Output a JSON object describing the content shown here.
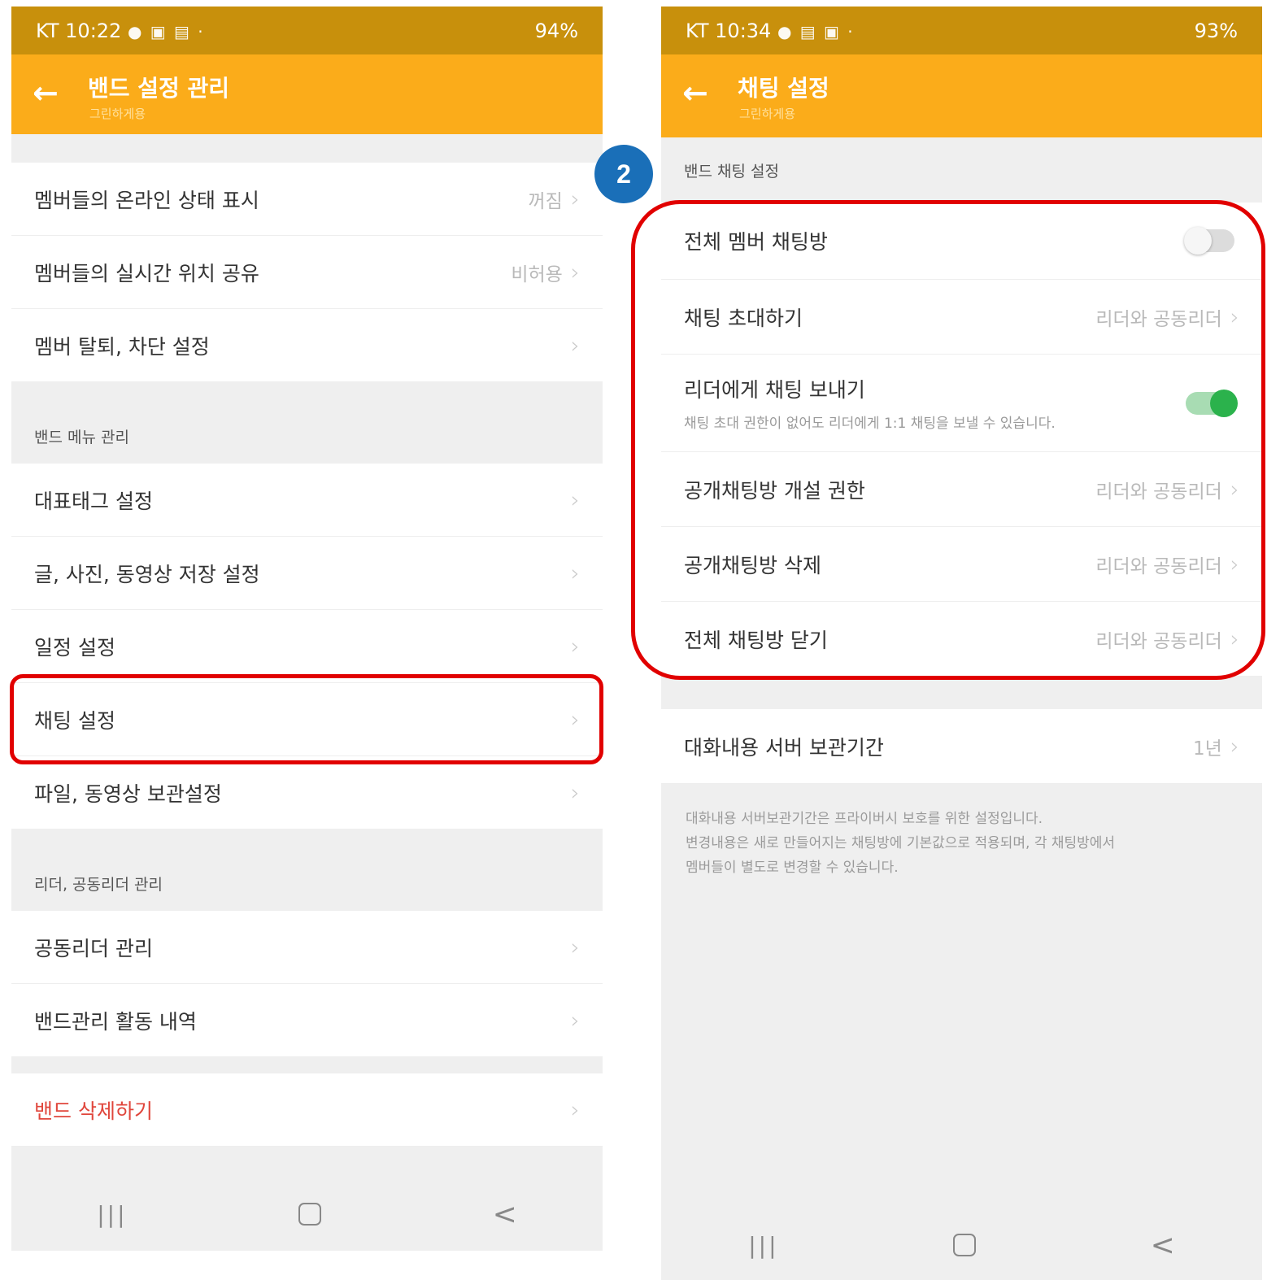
{
  "left": {
    "status": {
      "carrier_time": "KT 10:22",
      "icons": "● ▣ ▤ ·",
      "right": "94%"
    },
    "appbar": {
      "title": "밴드 설정 관리",
      "subtitle": "그린하게용"
    },
    "group1": [
      {
        "label": "멤버들의 온라인 상태 표시",
        "value": "꺼짐"
      },
      {
        "label": "멤버들의 실시간 위치 공유",
        "value": "비허용"
      },
      {
        "label": "멤버 탈퇴, 차단 설정",
        "value": ""
      }
    ],
    "section_menu": "밴드 메뉴 관리",
    "group2": [
      {
        "label": "대표태그 설정"
      },
      {
        "label": "글, 사진, 동영상 저장 설정"
      },
      {
        "label": "일정 설정"
      },
      {
        "label": "채팅 설정"
      },
      {
        "label": "파일, 동영상 보관설정"
      }
    ],
    "section_leader": "리더, 공동리더 관리",
    "group3": [
      {
        "label": "공동리더 관리"
      },
      {
        "label": "밴드관리 활동 내역"
      }
    ],
    "delete_band": "밴드 삭제하기",
    "nav": {
      "recent": "|||",
      "home": "",
      "back": "<"
    }
  },
  "badge": "2",
  "right": {
    "status": {
      "carrier_time": "KT 10:34",
      "icons": "● ▤ ▣ ·",
      "right": "93%"
    },
    "appbar": {
      "title": "채팅 설정",
      "subtitle": "그린하게용"
    },
    "section_title": "밴드 채팅 설정",
    "rows": {
      "all_member_chat": {
        "label": "전체 멤버 채팅방",
        "toggle": "off"
      },
      "invite_chat": {
        "label": "채팅 초대하기",
        "value": "리더와 공동리더"
      },
      "send_to_leader": {
        "label": "리더에게 채팅 보내기",
        "desc": "채팅 초대 권한이 없어도 리더에게 1:1 채팅을 보낼 수 있습니다.",
        "toggle": "on"
      },
      "open_chat_create": {
        "label": "공개채팅방 개설 권한",
        "value": "리더와 공동리더"
      },
      "open_chat_delete": {
        "label": "공개채팅방 삭제",
        "value": "리더와 공동리더"
      },
      "close_all_chat": {
        "label": "전체 채팅방 닫기",
        "value": "리더와 공동리더"
      }
    },
    "retention": {
      "label": "대화내용 서버 보관기간",
      "value": "1년"
    },
    "footnote": "대화내용 서버보관기간은 프라이버시 보호를 위한 설정입니다.\n변경내용은 새로 만들어지는 채팅방에 기본값으로 적용되며, 각 채팅방에서\n멤버들이 별도로 변경할 수 있습니다.",
    "nav": {
      "recent": "|||",
      "home": "",
      "back": "<"
    }
  },
  "colors": {
    "appbar": "#fbac1a",
    "statusbar": "#c8900c",
    "highlight": "#e10000",
    "badge": "#1a6fb8",
    "toggle_on": "#2bb24c",
    "danger": "#e0463c"
  }
}
